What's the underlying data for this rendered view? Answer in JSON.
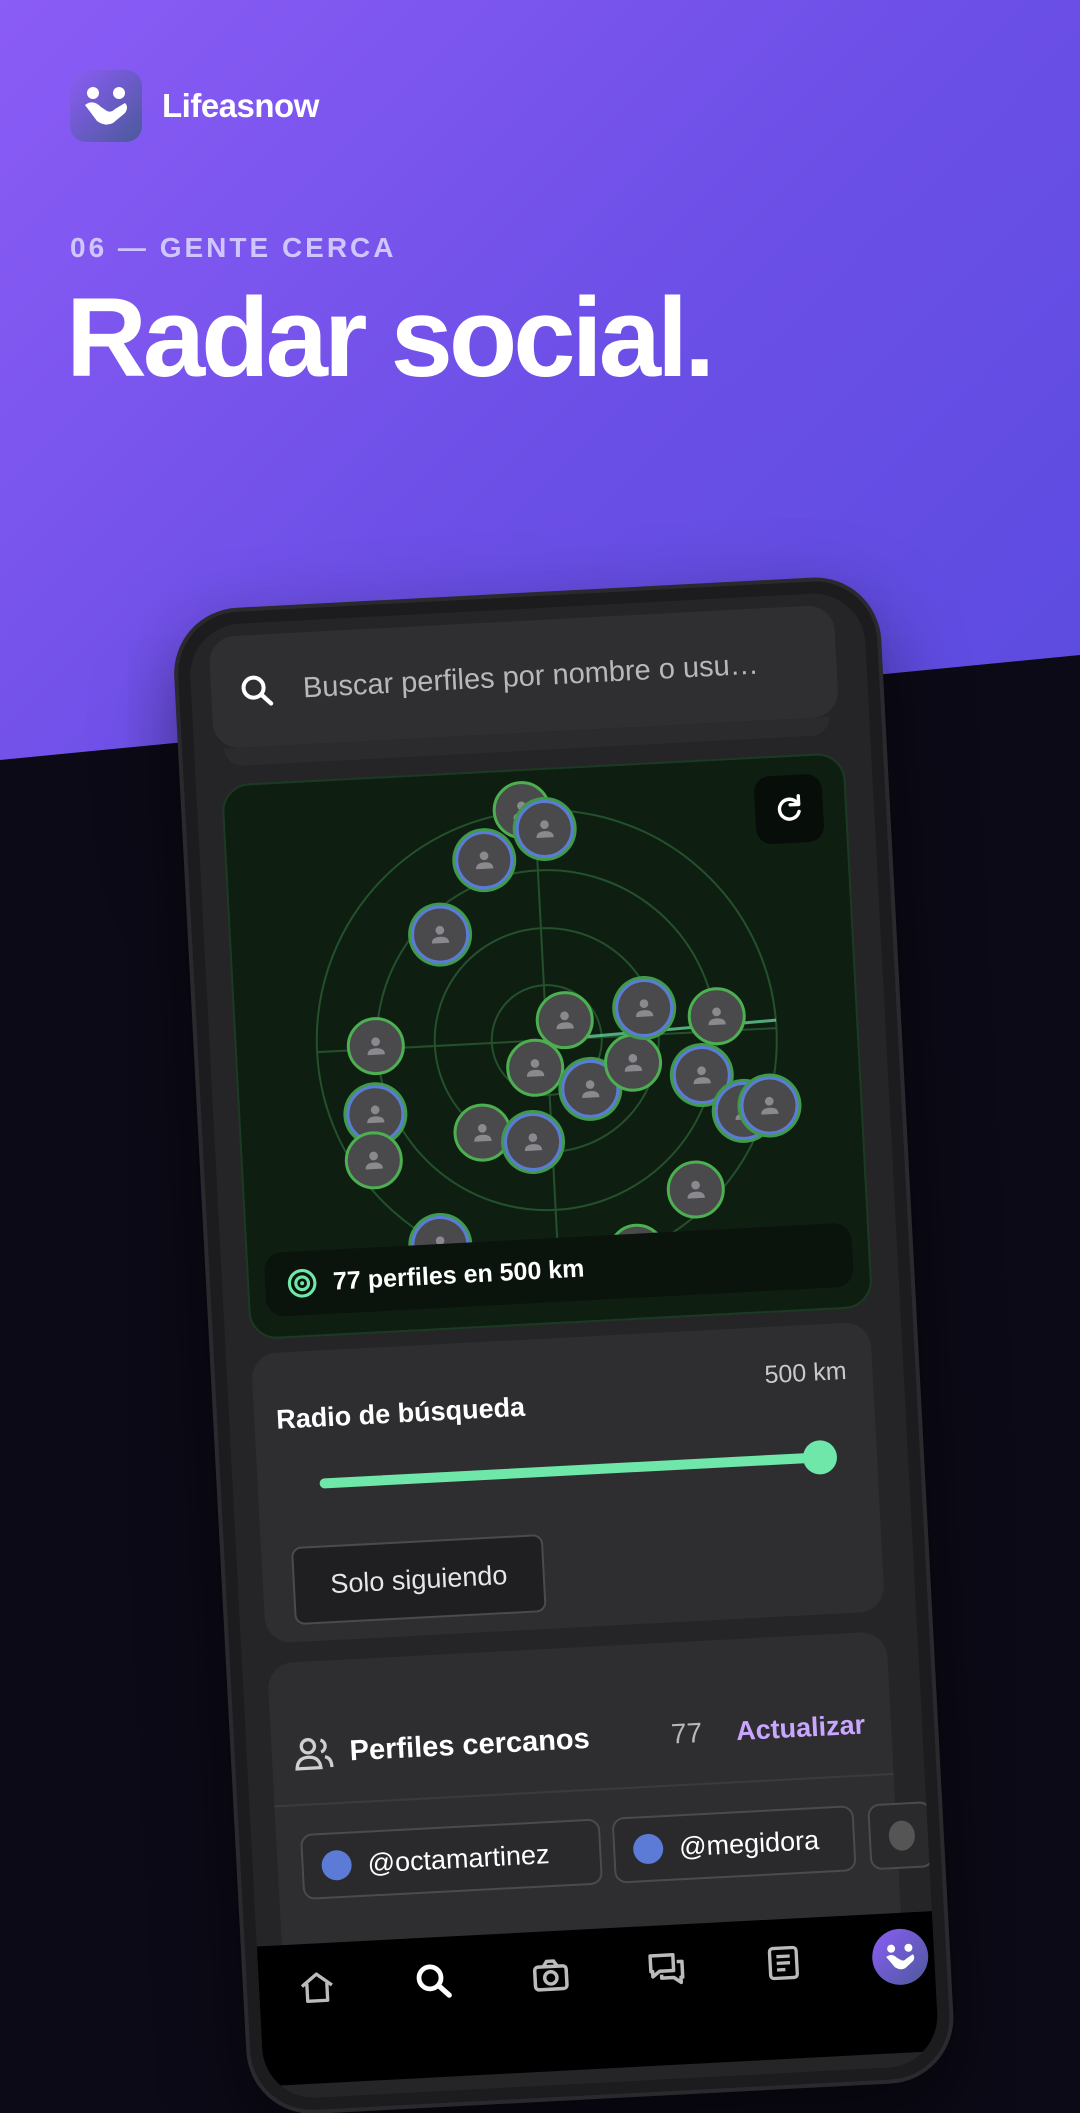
{
  "brand": {
    "name": "Lifeasnow",
    "logo_icon": "hands-logo-icon"
  },
  "hero": {
    "eyebrow": "06 — GENTE CERCA",
    "title": "Radar social."
  },
  "search": {
    "placeholder": "Buscar perfiles por nombre o usu…",
    "icon": "search-icon"
  },
  "radar": {
    "status": "77 perfiles en 500 km",
    "refresh_icon": "refresh-icon",
    "accent": "#6ee7a8"
  },
  "radius": {
    "label": "Radio de búsqueda",
    "value": "500 km",
    "level": 1.0
  },
  "filter": {
    "following_only": "Solo siguiendo"
  },
  "nearby": {
    "title": "Perfiles cercanos",
    "count": "77",
    "update": "Actualizar",
    "users": [
      "@octamartinez",
      "@megidora"
    ]
  },
  "nav": {
    "items": [
      "home-icon",
      "search-icon",
      "camera-icon",
      "chat-icon",
      "feed-icon",
      "profile-icon"
    ]
  },
  "colors": {
    "gradient_start": "#8b5cf6",
    "gradient_end": "#5b4be0",
    "dark_bg": "#0b0a16"
  }
}
